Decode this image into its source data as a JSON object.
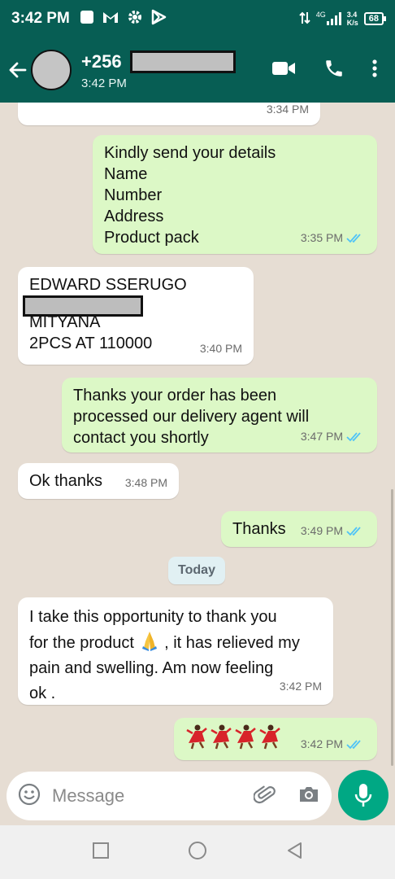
{
  "status_bar": {
    "time": "3:42 PM",
    "network_label": "4G",
    "speed_value": "3.4",
    "speed_unit": "K/s",
    "battery": "68"
  },
  "header": {
    "contact_prefix": "+256",
    "subtitle": "3:42 PM"
  },
  "messages": [
    {
      "dir": "in",
      "lines": [],
      "time": "3:34 PM"
    },
    {
      "dir": "out",
      "lines": [
        "Kindly send your details",
        "Name",
        "Number",
        "Address",
        "Product pack"
      ],
      "time": "3:35 PM",
      "read": true
    },
    {
      "dir": "in",
      "lines": [
        "EDWARD SSERUGO",
        "MITYANA",
        "2PCS AT 110000"
      ],
      "time": "3:40 PM"
    },
    {
      "dir": "out",
      "lines": [
        "Thanks your order has been",
        "processed our delivery agent will",
        "contact you shortly"
      ],
      "time": "3:47 PM",
      "read": true
    },
    {
      "dir": "in",
      "lines": [
        "Ok thanks"
      ],
      "time": "3:48 PM"
    },
    {
      "dir": "out",
      "lines": [
        "Thanks"
      ],
      "time": "3:49 PM",
      "read": true
    },
    {
      "dir": "in",
      "lines": [
        "I take this opportunity to thank you",
        "for the product",
        ", it has relieved my",
        "pain and swelling. Am now feeling",
        "ok ."
      ],
      "emoji": "folded-hands",
      "time": "3:42 PM"
    },
    {
      "dir": "out",
      "lines": [],
      "emoji": "dancer-x4",
      "time": "3:42 PM",
      "read": true
    }
  ],
  "date_separator": "Today",
  "input": {
    "placeholder": "Message"
  },
  "icons": {
    "back": "arrow-left-icon",
    "video": "video-call-icon",
    "call": "phone-icon",
    "menu": "more-vert-icon",
    "emoji": "emoji-icon",
    "attach": "paperclip-icon",
    "camera": "camera-icon",
    "mic": "mic-icon"
  },
  "colors": {
    "header": "#075e54",
    "outgoing_bubble": "#dcf8c6",
    "incoming_bubble": "#ffffff",
    "read_ticks": "#4fc3f7",
    "mic_button": "#00a884",
    "chat_background": "#e6ddd3"
  }
}
